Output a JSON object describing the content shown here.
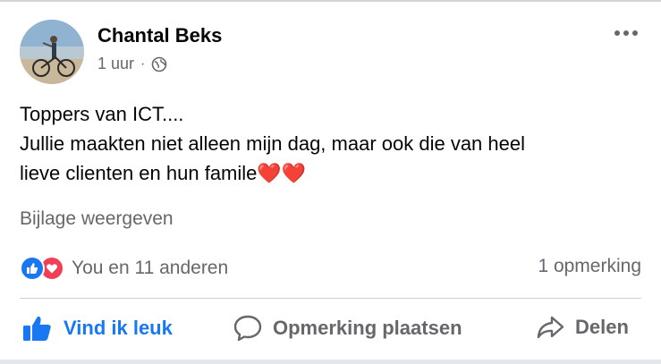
{
  "post": {
    "author": "Chantal Beks",
    "time": "1 uur",
    "separator": "·",
    "text_lines": [
      "Toppers van ICT....",
      "Jullie maakten niet alleen mijn dag, maar ook die van heel",
      "lieve clienten en hun famile"
    ],
    "hearts": "❤️❤️",
    "attachment_link": "Bijlage weergeven"
  },
  "engagement": {
    "reactions_text": "You en 11 anderen",
    "comments_text": "1 opmerking"
  },
  "actions": {
    "like_label": "Vind ik leuk",
    "comment_label": "Opmerking plaatsen",
    "share_label": "Delen"
  },
  "colors": {
    "like_blue": "#1877f2",
    "love_red": "#f33e58",
    "muted_text": "#65676b"
  },
  "icons": {
    "privacy": "globe-icon",
    "more": "more-options-icon",
    "like_reaction": "thumbs-up-reaction-icon",
    "love_reaction": "heart-reaction-icon",
    "like_action": "thumbs-up-icon",
    "comment_action": "comment-bubble-icon",
    "share_action": "share-arrow-icon"
  }
}
